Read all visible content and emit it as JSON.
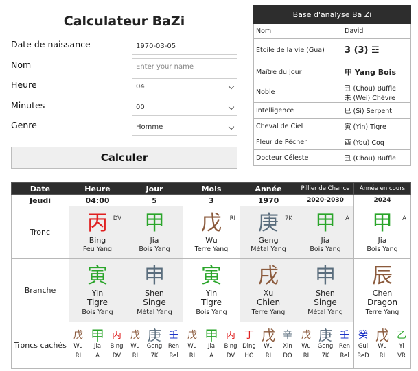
{
  "form": {
    "title": "Calculateur BaZi",
    "birthdate_label": "Date de naissance",
    "birthdate_value": "1970-03-05",
    "name_label": "Nom",
    "name_placeholder": "Enter your name",
    "hour_label": "Heure",
    "hour_value": "04",
    "minutes_label": "Minutes",
    "minutes_value": "00",
    "gender_label": "Genre",
    "gender_value": "Homme",
    "submit_label": "Calculer"
  },
  "analysis": {
    "title": "Base d'analyse Ba Zi",
    "rows": [
      {
        "k": "Nom",
        "v": "David"
      },
      {
        "k": "Etoile de la vie (Gua)",
        "v": "3 (3) ☲"
      },
      {
        "k": "Maître du Jour",
        "v": "甲 Yang Bois"
      },
      {
        "k": "Noble",
        "v": "丑 (Chou) Buffle",
        "v2": "未 (Wei) Chèvre"
      },
      {
        "k": "Intelligence",
        "v": "巳 (Si) Serpent"
      },
      {
        "k": "Cheval de Ciel",
        "v": "寅 (Yin) Tigre"
      },
      {
        "k": "Fleur de Pêcher",
        "v": "酉 (You) Coq"
      },
      {
        "k": "Docteur Céleste",
        "v": "丑 (Chou) Buffle"
      }
    ]
  },
  "pillars": {
    "headers": [
      "Date",
      "Heure",
      "Jour",
      "Mois",
      "Année",
      "Pillier de Chance",
      "Année en cours"
    ],
    "info": [
      "Jeudi",
      "04:00",
      "5",
      "3",
      "1970",
      "2020-2030",
      "2024"
    ],
    "labels": {
      "stem": "Tronc",
      "branch": "Branche",
      "hidden": "Troncs cachés"
    },
    "stems": [
      {
        "c": "丙",
        "p": "Bing",
        "e": "Feu Yang",
        "tag": "DV",
        "col": "#e02020"
      },
      {
        "c": "甲",
        "p": "Jia",
        "e": "Bois Yang",
        "tag": "",
        "col": "#2aa52a"
      },
      {
        "c": "戊",
        "p": "Wu",
        "e": "Terre Yang",
        "tag": "RI",
        "col": "#8b5a3c"
      },
      {
        "c": "庚",
        "p": "Geng",
        "e": "Métal Yang",
        "tag": "7K",
        "col": "#5a6d7d"
      },
      {
        "c": "甲",
        "p": "Jia",
        "e": "Bois Yang",
        "tag": "A",
        "col": "#2aa52a"
      },
      {
        "c": "甲",
        "p": "Jia",
        "e": "Bois Yang",
        "tag": "A",
        "col": "#2aa52a"
      }
    ],
    "branches": [
      {
        "c": "寅",
        "p": "Yin",
        "a": "Tigre",
        "e": "Bois Yang",
        "col": "#2aa52a"
      },
      {
        "c": "申",
        "p": "Shen",
        "a": "Singe",
        "e": "Métal Yang",
        "col": "#5a6d7d"
      },
      {
        "c": "寅",
        "p": "Yin",
        "a": "Tigre",
        "e": "Bois Yang",
        "col": "#2aa52a"
      },
      {
        "c": "戌",
        "p": "Xu",
        "a": "Chien",
        "e": "Terre Yang",
        "col": "#8b5a3c"
      },
      {
        "c": "申",
        "p": "Shen",
        "a": "Singe",
        "e": "Métal Yang",
        "col": "#5a6d7d"
      },
      {
        "c": "辰",
        "p": "Chen",
        "a": "Dragon",
        "e": "Terre Yang",
        "col": "#8b5a3c"
      }
    ],
    "hidden": [
      [
        {
          "c": "戊",
          "n": "Wu",
          "r": "RI",
          "col": "#8b5a3c"
        },
        {
          "c": "甲",
          "n": "Jia",
          "r": "A",
          "col": "#2aa52a"
        },
        {
          "c": "丙",
          "n": "Bing",
          "r": "DV",
          "col": "#e02020"
        }
      ],
      [
        {
          "c": "戊",
          "n": "Wu",
          "r": "RI",
          "col": "#8b5a3c"
        },
        {
          "c": "庚",
          "n": "Geng",
          "r": "7K",
          "col": "#5a6d7d"
        },
        {
          "c": "壬",
          "n": "Ren",
          "r": "Rel",
          "col": "#1c34c7"
        }
      ],
      [
        {
          "c": "戊",
          "n": "Wu",
          "r": "RI",
          "col": "#8b5a3c"
        },
        {
          "c": "甲",
          "n": "Jia",
          "r": "A",
          "col": "#2aa52a"
        },
        {
          "c": "丙",
          "n": "Bing",
          "r": "DV",
          "col": "#e02020"
        }
      ],
      [
        {
          "c": "丁",
          "n": "Ding",
          "r": "HO",
          "col": "#e02020"
        },
        {
          "c": "戊",
          "n": "Wu",
          "r": "RI",
          "col": "#8b5a3c"
        },
        {
          "c": "辛",
          "n": "Xin",
          "r": "DO",
          "col": "#5a6d7d"
        }
      ],
      [
        {
          "c": "戊",
          "n": "Wu",
          "r": "RI",
          "col": "#8b5a3c"
        },
        {
          "c": "庚",
          "n": "Geng",
          "r": "7K",
          "col": "#5a6d7d"
        },
        {
          "c": "壬",
          "n": "Ren",
          "r": "Rel",
          "col": "#1c34c7"
        }
      ],
      [
        {
          "c": "癸",
          "n": "Gui",
          "r": "ReD",
          "col": "#1c34c7"
        },
        {
          "c": "戊",
          "n": "Wu",
          "r": "RI",
          "col": "#8b5a3c"
        },
        {
          "c": "乙",
          "n": "Yi",
          "r": "VR",
          "col": "#2aa52a"
        }
      ]
    ]
  }
}
